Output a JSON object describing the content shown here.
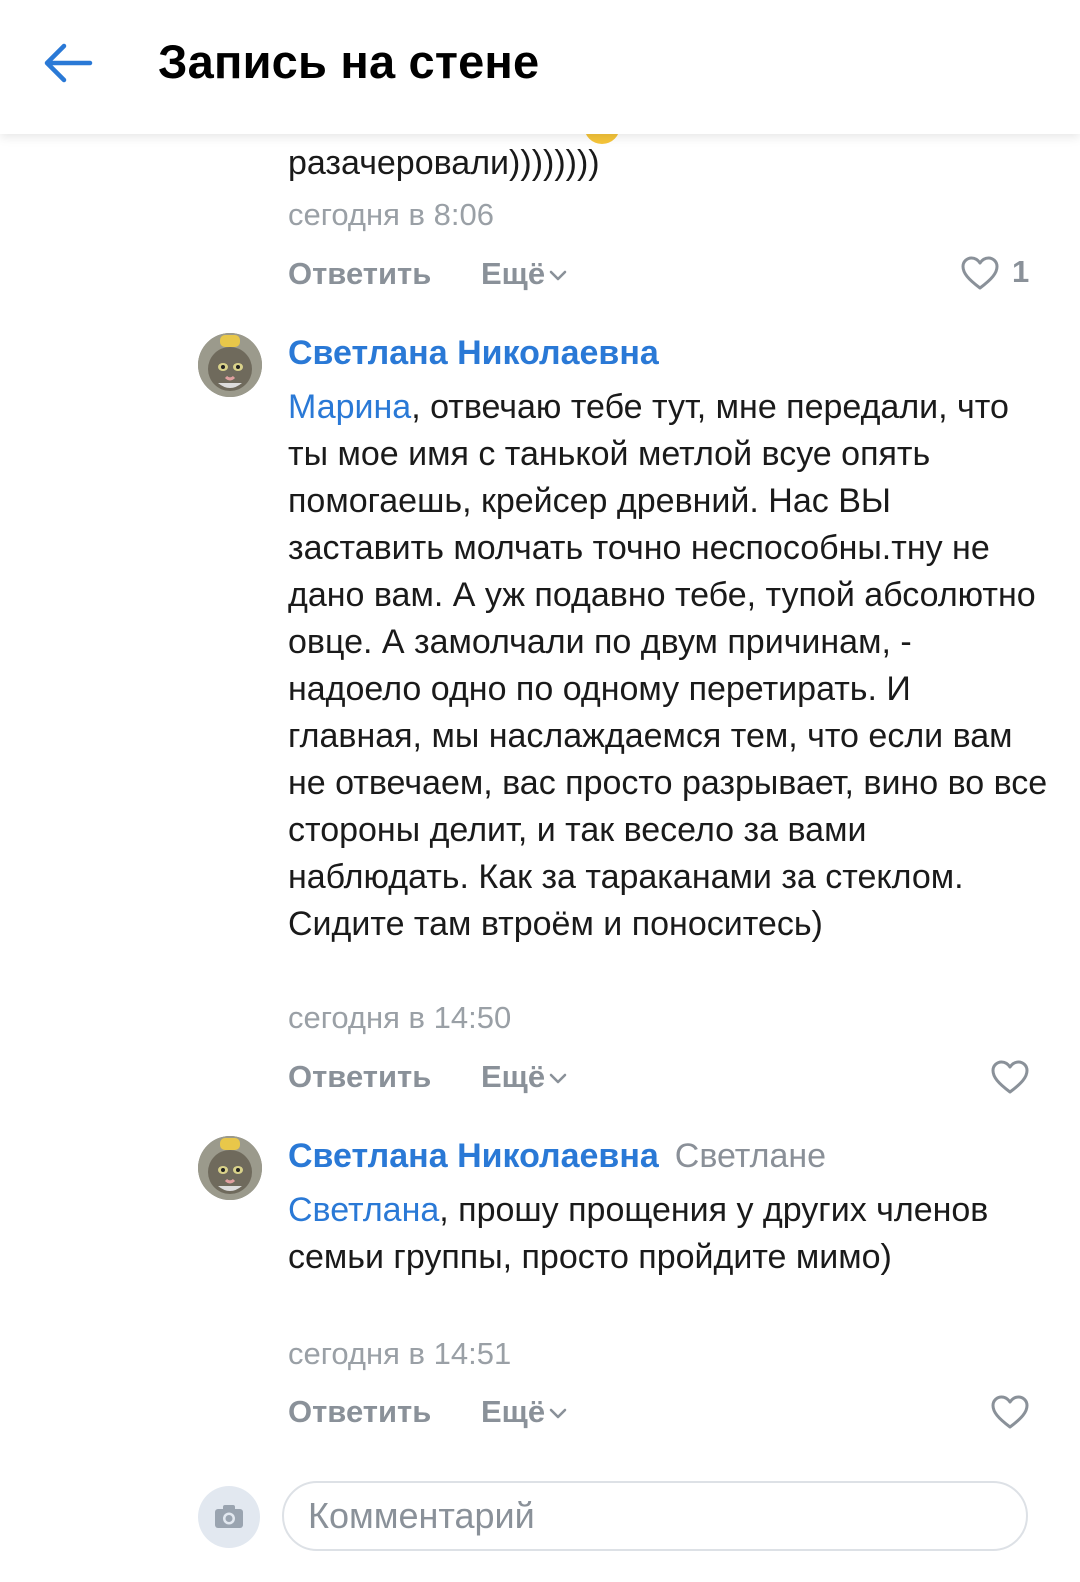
{
  "header": {
    "title": "Запись на стене"
  },
  "comments": [
    {
      "text_tail": "разачеровали))))))))",
      "time": "сегодня в 8:06",
      "reply_label": "Ответить",
      "more_label": "Ещё",
      "likes": "1"
    },
    {
      "author": "Светлана Николаевна",
      "mention": "Марина",
      "text": ", отвечаю тебе тут, мне передали, что ты мое имя с танькой метлой всуе опять помогаешь, крейсер древний. Нас ВЫ заставить молчать точно неспособны.тну не дано вам. А уж подавно тебе, тупой абсолютно овце. А замолчали по двум причинам, - надоело одно по одному перетирать. И главная, мы наслаждаемся тем, что если вам не отвечаем, вас просто разрывает, вино во все стороны делит, и так весело за вами наблюдать. Как за тараканами за стеклом. Сидите там втроём и поноситесь)",
      "time": "сегодня в 14:50",
      "reply_label": "Ответить",
      "more_label": "Ещё"
    },
    {
      "author": "Светлана Николаевна",
      "reply_to": "Светлане",
      "mention": "Светлана",
      "text": ", прошу прощения у других членов семьи группы, просто пройдите мимо)",
      "time": "сегодня в 14:51",
      "reply_label": "Ответить",
      "more_label": "Ещё"
    }
  ],
  "composer": {
    "placeholder": "Комментарий"
  },
  "colors": {
    "link": "#2a79d6",
    "muted": "#8a9199",
    "time": "#9aa0a6"
  },
  "icons": [
    "back-arrow-icon",
    "heart-icon",
    "chevron-down-icon",
    "camera-icon",
    "emoji-icon"
  ]
}
